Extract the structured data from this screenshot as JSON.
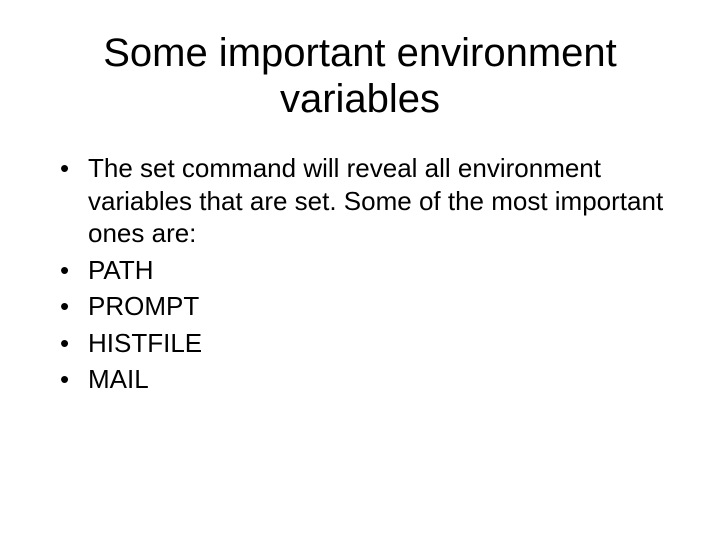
{
  "slide": {
    "title": "Some important environment variables",
    "bullets": [
      "The set command will reveal all environment variables that are set. Some of the most important ones are:",
      "PATH",
      "PROMPT",
      "HISTFILE",
      "MAIL"
    ]
  }
}
